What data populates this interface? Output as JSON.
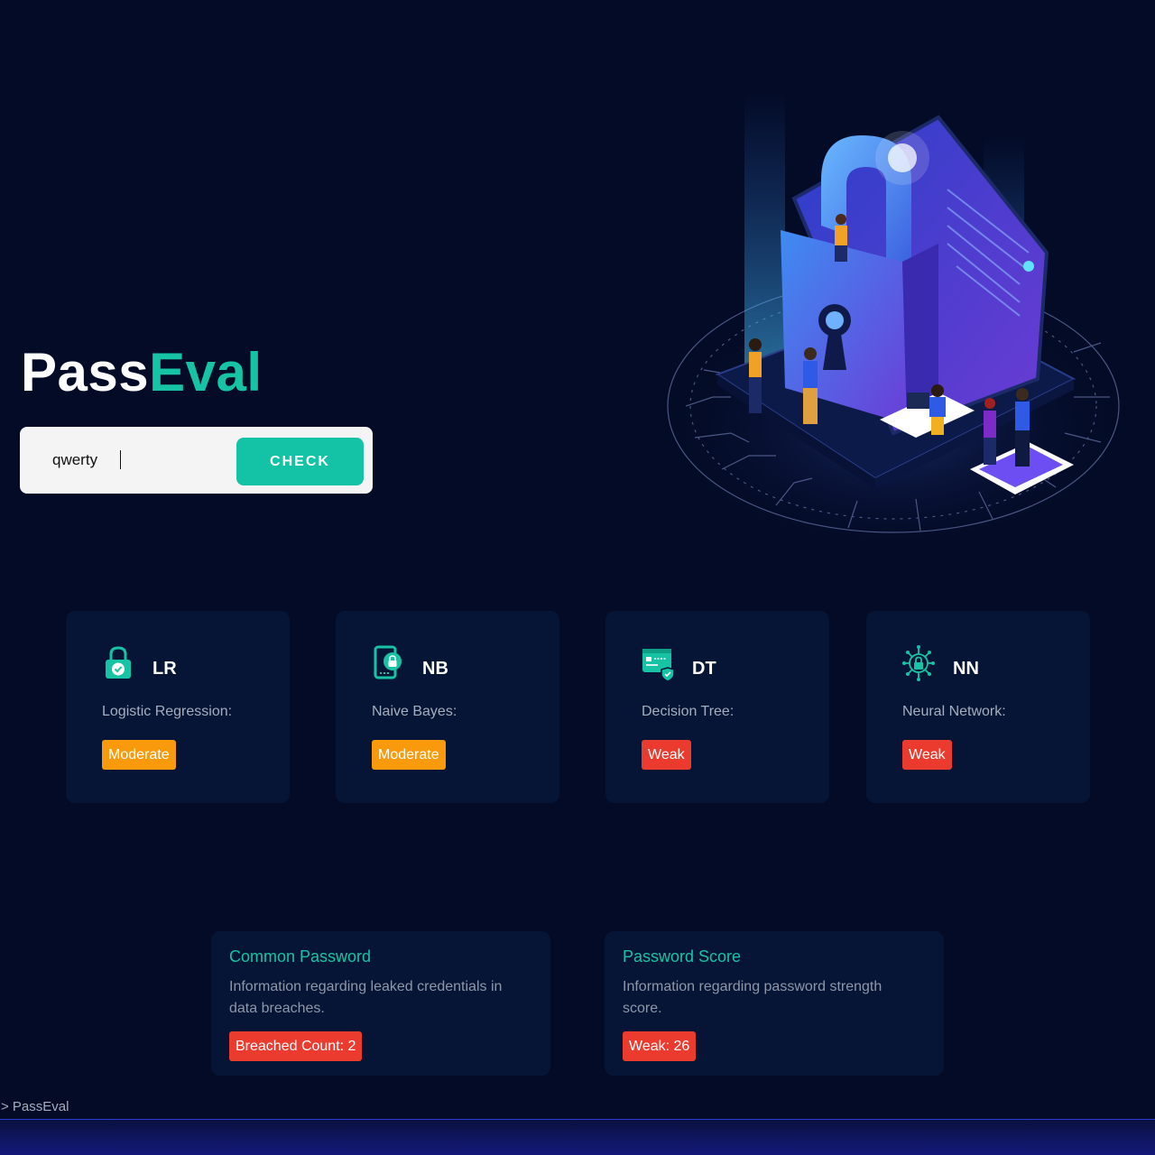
{
  "app": {
    "title_part1": "Pass",
    "title_part2": "Eval"
  },
  "search": {
    "value": "qwerty",
    "button_label": "CHECK"
  },
  "models": [
    {
      "abbr": "LR",
      "name": "Logistic Regression:",
      "result": "Moderate",
      "icon": "lock-check-icon"
    },
    {
      "abbr": "NB",
      "name": "Naive Bayes:",
      "result": "Moderate",
      "icon": "phone-lock-icon"
    },
    {
      "abbr": "DT",
      "name": "Decision Tree:",
      "result": "Weak",
      "icon": "card-shield-icon"
    },
    {
      "abbr": "NN",
      "name": "Neural Network:",
      "result": "Weak",
      "icon": "network-lock-icon"
    }
  ],
  "info": {
    "common": {
      "title": "Common Password",
      "description": "Information regarding leaked credentials in data breaches.",
      "badge": "Breached Count: 2"
    },
    "score": {
      "title": "Password Score",
      "description": "Information regarding password strength score.",
      "badge": "Weak: 26"
    }
  },
  "footer": {
    "label": "> PassEval"
  },
  "colors": {
    "accent": "#17c3a5",
    "background": "#030b26",
    "card": "#061535",
    "moderate": "#f89a0b",
    "weak": "#eb3b2f"
  }
}
